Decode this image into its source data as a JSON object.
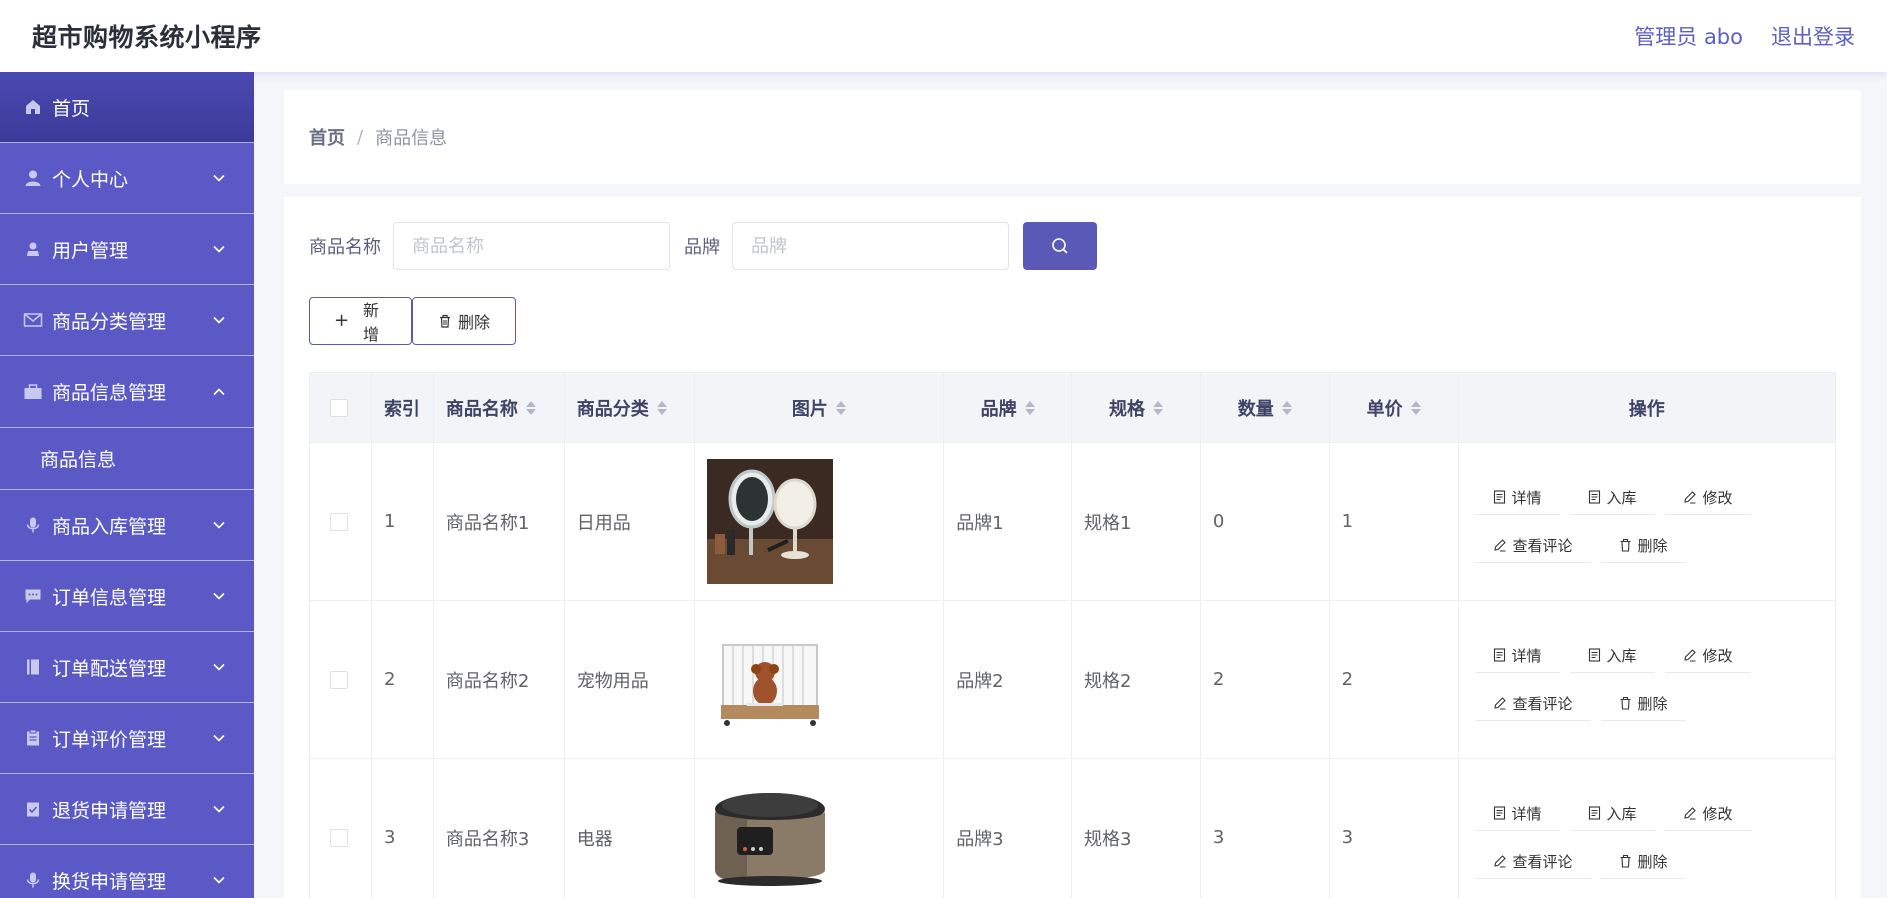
{
  "header": {
    "app_title": "超市购物系统小程序",
    "admin_label": "管理员 abo",
    "logout_label": "退出登录"
  },
  "sidebar": {
    "items": [
      {
        "label": "首页",
        "icon": "home-icon"
      },
      {
        "label": "个人中心",
        "icon": "user-icon"
      },
      {
        "label": "用户管理",
        "icon": "users-icon"
      },
      {
        "label": "商品分类管理",
        "icon": "mail-icon"
      },
      {
        "label": "商品信息管理",
        "icon": "briefcase-icon"
      },
      {
        "label": "商品入库管理",
        "icon": "mic-icon"
      },
      {
        "label": "订单信息管理",
        "icon": "chat-icon"
      },
      {
        "label": "订单配送管理",
        "icon": "book-icon"
      },
      {
        "label": "订单评价管理",
        "icon": "clipboard-icon"
      },
      {
        "label": "退货申请管理",
        "icon": "checklist-icon"
      },
      {
        "label": "换货申请管理",
        "icon": "mic-icon"
      }
    ],
    "submenu": {
      "label": "商品信息"
    }
  },
  "breadcrumb": {
    "home": "首页",
    "separator": "/",
    "current": "商品信息"
  },
  "search": {
    "name_label": "商品名称",
    "name_placeholder": "商品名称",
    "brand_label": "品牌",
    "brand_placeholder": "品牌"
  },
  "toolbar": {
    "add_label": "新增",
    "delete_label": "删除"
  },
  "table": {
    "headers": {
      "index": "索引",
      "name": "商品名称",
      "category": "商品分类",
      "image": "图片",
      "brand": "品牌",
      "spec": "规格",
      "quantity": "数量",
      "price": "单价",
      "actions": "操作"
    },
    "rows": [
      {
        "index": "1",
        "name": "商品名称1",
        "category": "日用品",
        "brand": "品牌1",
        "spec": "规格1",
        "quantity": "0",
        "price": "1"
      },
      {
        "index": "2",
        "name": "商品名称2",
        "category": "宠物用品",
        "brand": "品牌2",
        "spec": "规格2",
        "quantity": "2",
        "price": "2"
      },
      {
        "index": "3",
        "name": "商品名称3",
        "category": "电器",
        "brand": "品牌3",
        "spec": "规格3",
        "quantity": "3",
        "price": "3"
      }
    ],
    "actions": {
      "detail": "详情",
      "stock_in": "入库",
      "edit": "修改",
      "reviews": "查看评论",
      "delete": "删除"
    }
  },
  "colors": {
    "primary": "#5a59b8",
    "sidebar": "#5a59c6",
    "sidebar_active": "#3c3b9a"
  }
}
